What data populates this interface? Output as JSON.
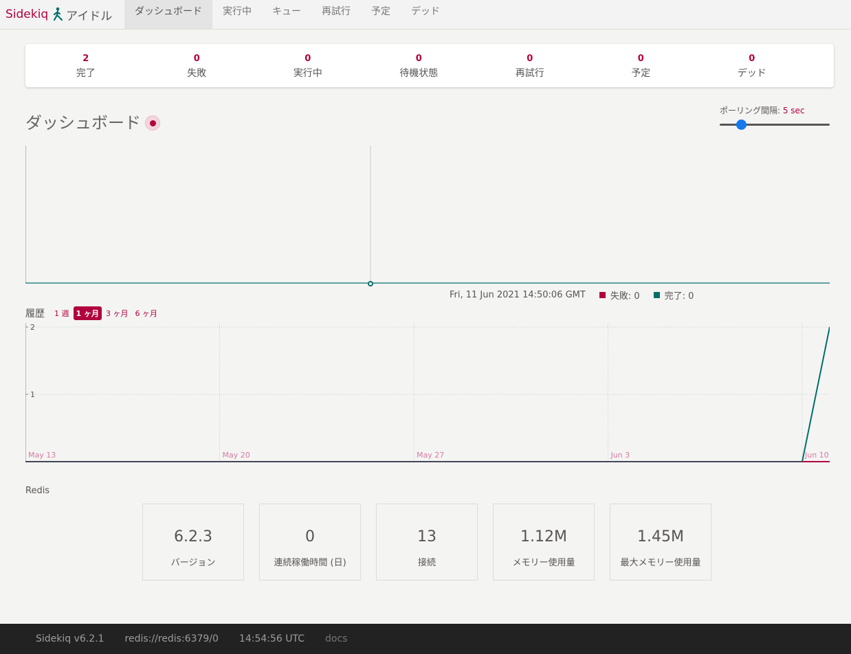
{
  "brand": {
    "name": "Sidekiq",
    "status": "アイドル"
  },
  "nav": {
    "items": [
      {
        "label": "ダッシュボード",
        "active": true
      },
      {
        "label": "実行中"
      },
      {
        "label": "キュー"
      },
      {
        "label": "再試行"
      },
      {
        "label": "予定"
      },
      {
        "label": "デッド"
      }
    ]
  },
  "summary": [
    {
      "count": "2",
      "label": "完了"
    },
    {
      "count": "0",
      "label": "失敗"
    },
    {
      "count": "0",
      "label": "実行中"
    },
    {
      "count": "0",
      "label": "待機状態"
    },
    {
      "count": "0",
      "label": "再試行"
    },
    {
      "count": "0",
      "label": "予定"
    },
    {
      "count": "0",
      "label": "デッド"
    }
  ],
  "dashboard": {
    "title": "ダッシュボード",
    "poll_label": "ポーリング間隔: ",
    "poll_value": "5 sec",
    "poll_fraction": 0.2
  },
  "realtime": {
    "timestamp": "Fri, 11 Jun 2021 14:50:06 GMT",
    "failed_label": "失敗: 0",
    "processed_label": "完了: 0",
    "colors": {
      "failed": "#b1003e",
      "processed": "#006f68"
    }
  },
  "history": {
    "title": "履歴",
    "ranges": [
      {
        "label": "1 週"
      },
      {
        "label": "1 ヶ月",
        "active": true
      },
      {
        "label": "3 ヶ月"
      },
      {
        "label": "6 ヶ月"
      }
    ]
  },
  "chart_data": {
    "type": "line",
    "x": [
      "May 13",
      "May 20",
      "May 27",
      "Jun 3",
      "Jun 10",
      "Jun 11"
    ],
    "series": [
      {
        "values": [
          0,
          0,
          0,
          0,
          0,
          2
        ]
      },
      {
        "values": [
          0,
          0,
          0,
          0,
          0,
          0
        ]
      }
    ],
    "ylim": [
      0,
      2
    ],
    "yticks": [
      "1",
      "2"
    ],
    "xticks": [
      "May 13",
      "May 20",
      "May 27",
      "Jun 3",
      "Jun 10"
    ],
    "colors": {
      "processed": "#006f68",
      "failed": "#b1003e"
    },
    "grid": true
  },
  "redis": {
    "title": "Redis",
    "stats": [
      {
        "value": "6.2.3",
        "label": "バージョン"
      },
      {
        "value": "0",
        "label": "連続稼働時間 (日)"
      },
      {
        "value": "13",
        "label": "接続"
      },
      {
        "value": "1.12M",
        "label": "メモリー使用量"
      },
      {
        "value": "1.45M",
        "label": "最大メモリー使用量"
      }
    ]
  },
  "footer": {
    "version": "Sidekiq v6.2.1",
    "redis_url": "redis://redis:6379/0",
    "time": "14:54:56 UTC",
    "docs": "docs"
  }
}
